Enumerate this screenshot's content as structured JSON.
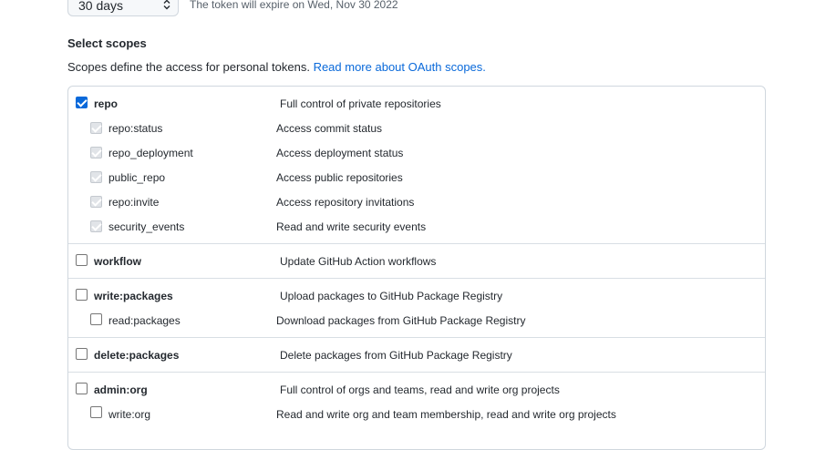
{
  "expiration": {
    "selected": "30 days",
    "note": "The token will expire on Wed, Nov 30 2022"
  },
  "scopes_heading": "Select scopes",
  "scopes_description": "Scopes define the access for personal tokens.",
  "scopes_link": "Read more about OAuth scopes.",
  "scopes": {
    "repo": {
      "label": "repo",
      "description": "Full control of private repositories",
      "checked": true,
      "children": [
        {
          "label": "repo:status",
          "description": "Access commit status"
        },
        {
          "label": "repo_deployment",
          "description": "Access deployment status"
        },
        {
          "label": "public_repo",
          "description": "Access public repositories"
        },
        {
          "label": "repo:invite",
          "description": "Access repository invitations"
        },
        {
          "label": "security_events",
          "description": "Read and write security events"
        }
      ]
    },
    "workflow": {
      "label": "workflow",
      "description": "Update GitHub Action workflows",
      "checked": false
    },
    "write_packages": {
      "label": "write:packages",
      "description": "Upload packages to GitHub Package Registry",
      "checked": false,
      "children": [
        {
          "label": "read:packages",
          "description": "Download packages from GitHub Package Registry"
        }
      ]
    },
    "delete_packages": {
      "label": "delete:packages",
      "description": "Delete packages from GitHub Package Registry",
      "checked": false
    },
    "admin_org": {
      "label": "admin:org",
      "description": "Full control of orgs and teams, read and write org projects",
      "checked": false,
      "children": [
        {
          "label": "write:org",
          "description": "Read and write org and team membership, read and write org projects"
        }
      ]
    }
  },
  "colors": {
    "link": "#0969da",
    "checkbox_checked": "#0969da",
    "border": "#d0d7de"
  }
}
